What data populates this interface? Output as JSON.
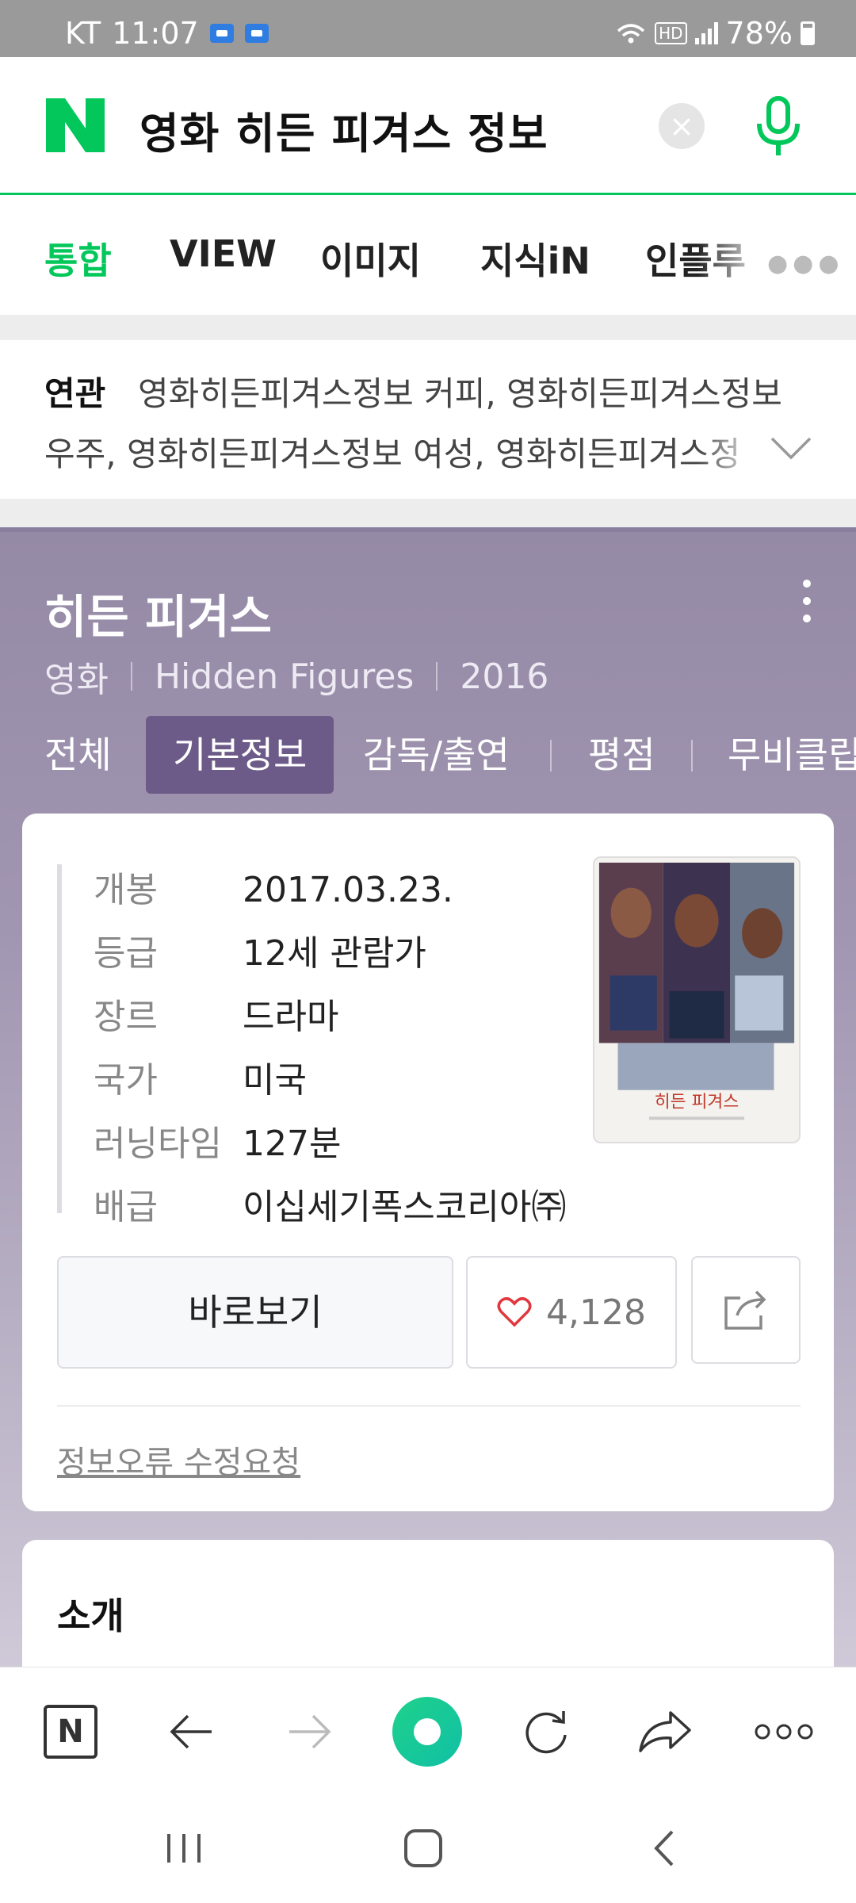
{
  "status_bar": {
    "carrier": "KT",
    "time": "11:07",
    "network": "HD",
    "battery": "78%"
  },
  "search": {
    "query": "영화 히든 피겨스 정보"
  },
  "tabs": [
    {
      "label": "통합",
      "active": true
    },
    {
      "label": "VIEW"
    },
    {
      "label": "이미지"
    },
    {
      "label": "지식iN"
    },
    {
      "label": "인플루"
    }
  ],
  "related": {
    "label": "연관",
    "line1": "영화히든피겨스정보 커피, 영화히든피겨스정보",
    "line2": "우주, 영화히든피겨스정보 여성, 영화히든피겨스정"
  },
  "movie": {
    "title": "히든 피겨스",
    "category": "영화",
    "original_title": "Hidden Figures",
    "year": "2016",
    "subtabs": [
      "전체",
      "기본정보",
      "감독/출연",
      "평점",
      "무비클립"
    ],
    "info": [
      {
        "key": "개봉",
        "value": "2017.03.23."
      },
      {
        "key": "등급",
        "value": "12세 관람가"
      },
      {
        "key": "장르",
        "value": "드라마"
      },
      {
        "key": "국가",
        "value": "미국"
      },
      {
        "key": "러닝타임",
        "value": "127분"
      },
      {
        "key": "배급",
        "value": "이십세기폭스코리아㈜"
      }
    ],
    "watch_label": "바로보기",
    "likes": "4,128",
    "report_link": "정보오류 수정요청",
    "poster_title": "히든 피겨스",
    "intro_title": "소개"
  },
  "colors": {
    "naver_green": "#03c75a",
    "panel_purple": "#9a8faa",
    "active_subtab": "#6c5a88",
    "heart_red": "#e0383e"
  }
}
